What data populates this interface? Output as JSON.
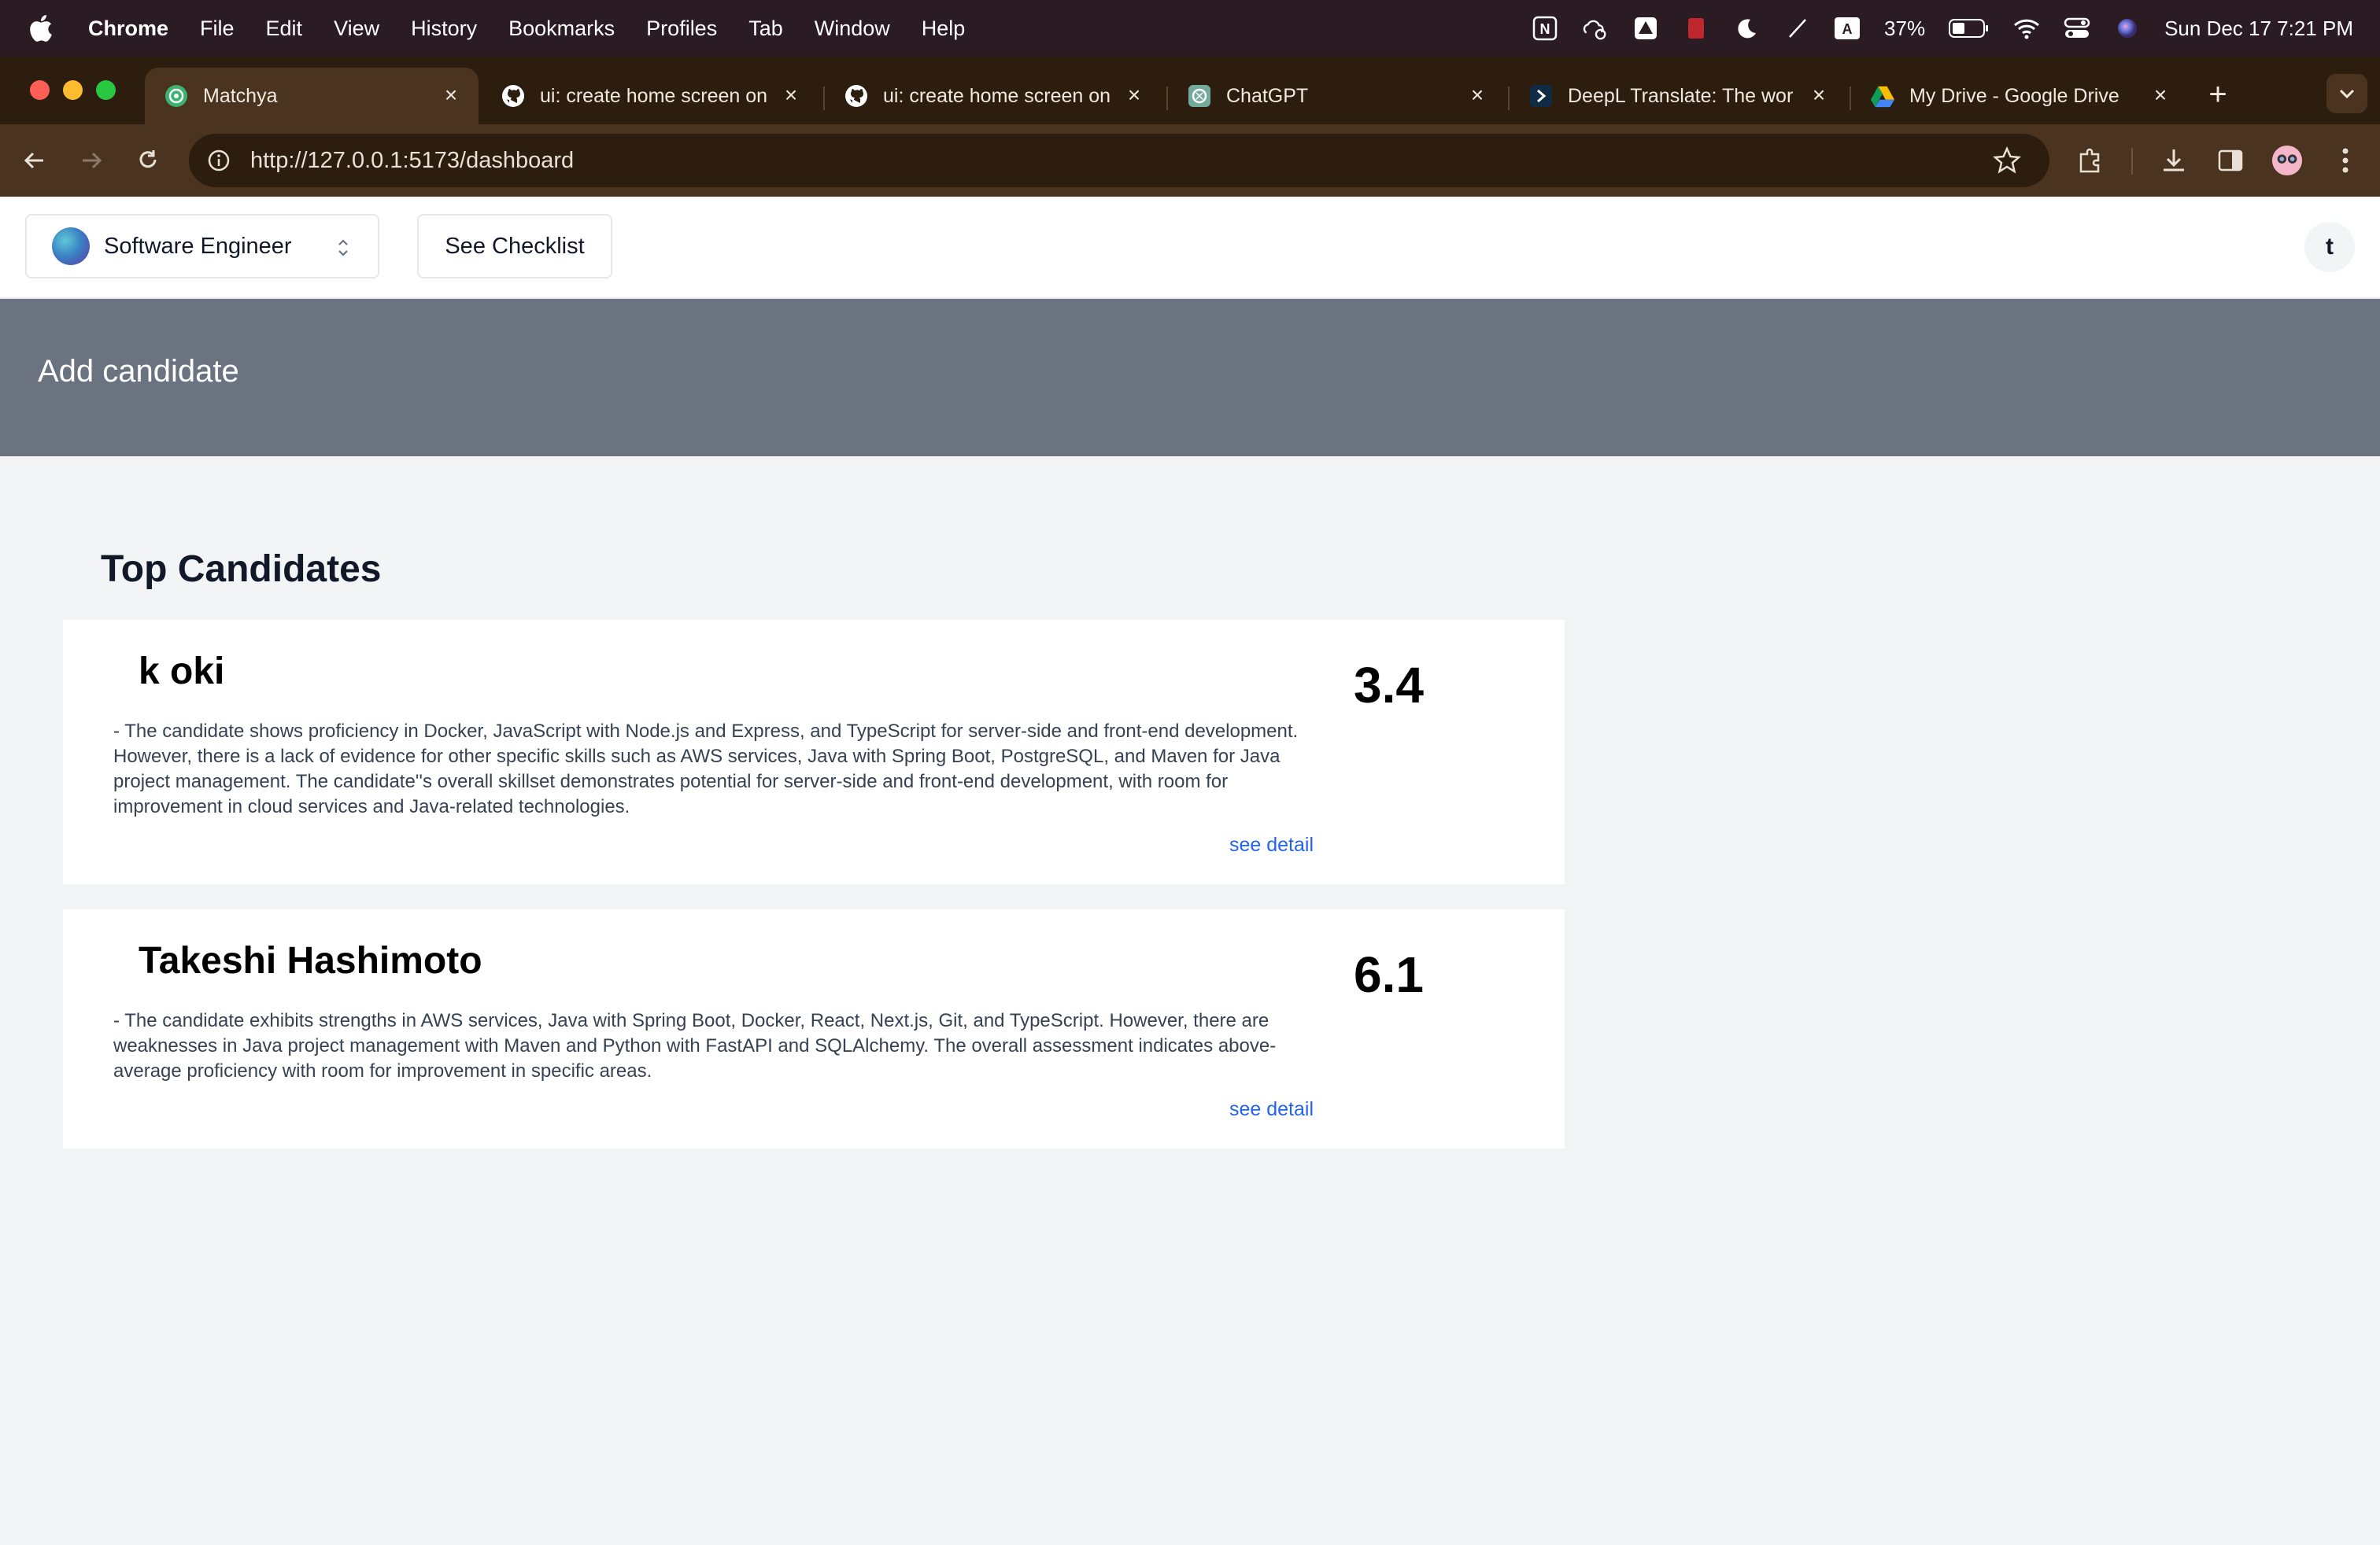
{
  "menubar": {
    "app_name": "Chrome",
    "items": [
      "File",
      "Edit",
      "View",
      "History",
      "Bookmarks",
      "Profiles",
      "Tab",
      "Window",
      "Help"
    ],
    "battery": "37%",
    "datetime": "Sun Dec 17  7:21 PM"
  },
  "browser": {
    "tabs": [
      {
        "title": "Matchya",
        "icon": "matchya-icon"
      },
      {
        "title": "ui: create home screen on",
        "icon": "github-icon"
      },
      {
        "title": "ui: create home screen on",
        "icon": "github-icon"
      },
      {
        "title": "ChatGPT",
        "icon": "chatgpt-icon"
      },
      {
        "title": "DeepL Translate: The wor",
        "icon": "deepl-icon"
      },
      {
        "title": "My Drive - Google Drive",
        "icon": "google-drive-icon"
      }
    ],
    "url": "http://127.0.0.1:5173/dashboard"
  },
  "header": {
    "role_label": "Software Engineer",
    "checklist_label": "See Checklist",
    "avatar_initial": "t"
  },
  "hero": {
    "title": "Add candidate"
  },
  "candidates_section": {
    "title": "Top Candidates",
    "candidates": [
      {
        "name": "k oki",
        "score": "3.4",
        "summary": "- The candidate shows proficiency in Docker, JavaScript with Node.js and Express, and TypeScript for server-side and front-end development. However, there is a lack of evidence for other specific skills such as AWS services, Java with Spring Boot, PostgreSQL, and Maven for Java project management. The candidate''s overall skillset demonstrates potential for server-side and front-end development, with room for improvement in cloud services and Java-related technologies.",
        "link": "see detail"
      },
      {
        "name": "Takeshi Hashimoto",
        "score": "6.1",
        "summary": "- The candidate exhibits strengths in AWS services, Java with Spring Boot, Docker, React, Next.js, Git, and TypeScript. However, there are weaknesses in Java project management with Maven and Python with FastAPI and SQLAlchemy. The overall assessment indicates above-average proficiency with room for improvement in specific areas.",
        "link": "see detail"
      }
    ]
  }
}
